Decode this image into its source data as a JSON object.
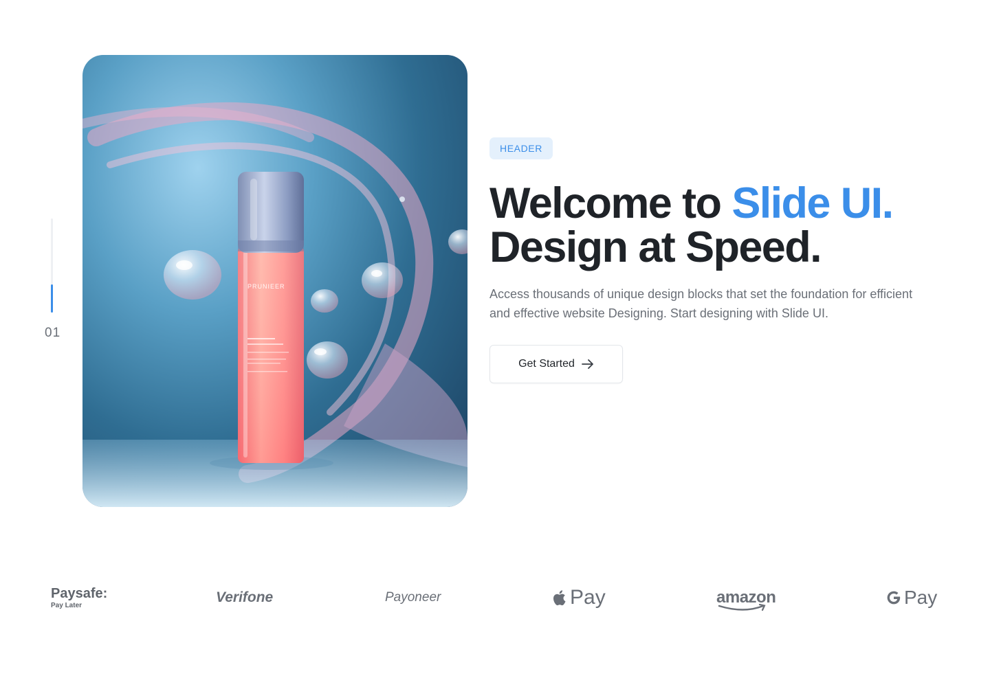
{
  "slider": {
    "number": "01",
    "progress": 0.3
  },
  "content": {
    "badge": "HEADER",
    "headline": {
      "part1": "Welcome to ",
      "accent": "Slide UI.",
      "part2": " Design at Speed."
    },
    "subtitle": "Access thousands of unique design blocks that set the foundation for efficient and effective website Designing. Start designing with Slide UI.",
    "cta_label": "Get Started",
    "cta_icon": "arrow-right-icon"
  },
  "product": {
    "label": "PRUNIEER"
  },
  "logos": [
    {
      "name": "Paysafe:",
      "sub": "Pay Later"
    },
    {
      "name": "Verifone"
    },
    {
      "name": "Payoneer"
    },
    {
      "name": "Pay",
      "icon": "apple-icon"
    },
    {
      "name": "amazon"
    },
    {
      "name": "Pay",
      "icon": "google-g-icon"
    }
  ],
  "colors": {
    "accent": "#3b8ee9",
    "text": "#1f2328",
    "muted": "#6a6f77",
    "badge_bg": "#e4f0fc"
  }
}
